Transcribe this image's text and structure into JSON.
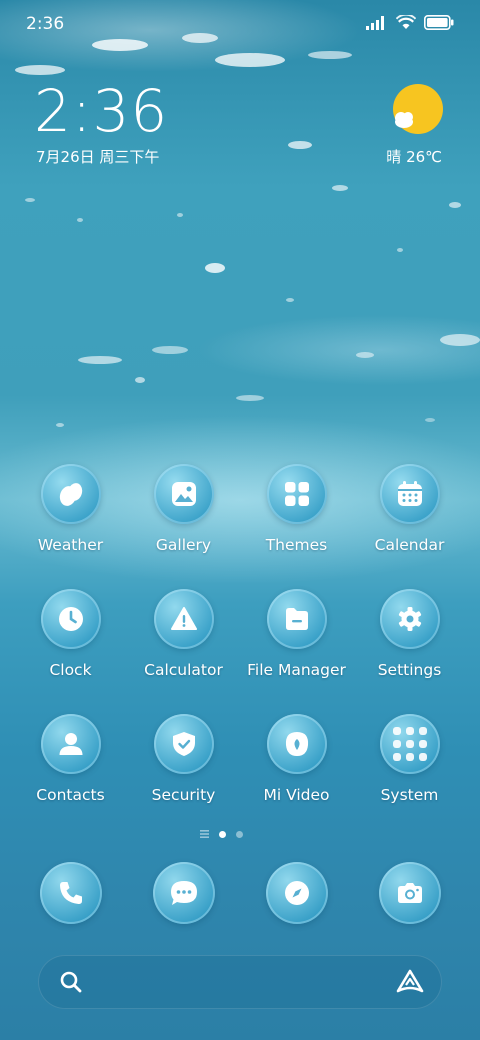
{
  "status_bar": {
    "time": "2:36"
  },
  "lockclock": {
    "time": "2:36",
    "date": "7月26日 周三下午"
  },
  "weather": {
    "text": "晴 26℃",
    "icon": "sunny-cloud-icon"
  },
  "apps": [
    [
      {
        "label": "Weather",
        "icon": "weather-icon"
      },
      {
        "label": "Gallery",
        "icon": "gallery-icon"
      },
      {
        "label": "Themes",
        "icon": "themes-icon"
      },
      {
        "label": "Calendar",
        "icon": "calendar-icon"
      }
    ],
    [
      {
        "label": "Clock",
        "icon": "clock-icon"
      },
      {
        "label": "Calculator",
        "icon": "calculator-icon"
      },
      {
        "label": "File Manager",
        "icon": "file-manager-icon"
      },
      {
        "label": "Settings",
        "icon": "settings-icon"
      }
    ],
    [
      {
        "label": "Contacts",
        "icon": "contacts-icon"
      },
      {
        "label": "Security",
        "icon": "security-icon"
      },
      {
        "label": "Mi Video",
        "icon": "mi-video-icon"
      },
      {
        "label": "System",
        "icon": "folder-icon"
      }
    ]
  ],
  "dock": [
    {
      "icon": "phone-icon"
    },
    {
      "icon": "messages-icon"
    },
    {
      "icon": "browser-icon"
    },
    {
      "icon": "camera-icon"
    }
  ],
  "pager": {
    "pages": 2,
    "current": 1
  },
  "colors": {
    "sun": "#f7c520",
    "icon_glyph": "#ffffff"
  }
}
